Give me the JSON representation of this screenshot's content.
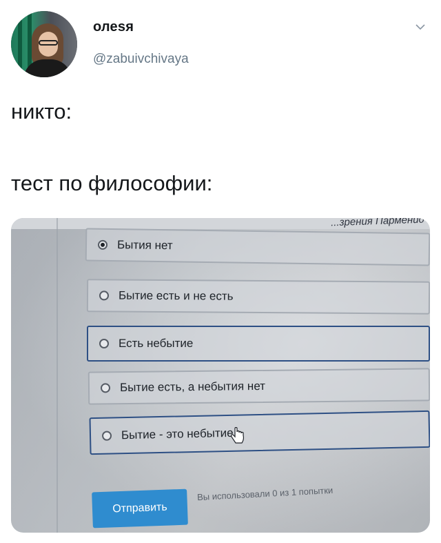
{
  "tweet": {
    "author_name": "олеsя",
    "author_handle": "@zabuivchivaya",
    "line1": "никто:",
    "line2": "тест по философии:"
  },
  "quiz": {
    "cut_text": "...зрения Парменид",
    "options": [
      {
        "label": "Бытия нет",
        "selected": true
      },
      {
        "label": "Бытие есть и не есть",
        "selected": false
      },
      {
        "label": "Есть небытие",
        "selected": false
      },
      {
        "label": "Бытие есть, а небытия нет",
        "selected": false
      },
      {
        "label": "Бытие - это небытие",
        "selected": false
      }
    ],
    "submit_label": "Отправить",
    "attempts_text": "Вы использовали 0 из 1 попытки"
  },
  "icons": {
    "menu": "chevron-down-icon",
    "cursor": "hand-cursor-icon"
  },
  "colors": {
    "text": "#14171a",
    "secondary": "#657786",
    "submit": "#2f8ccf",
    "selected_border": "#2d4f84"
  }
}
